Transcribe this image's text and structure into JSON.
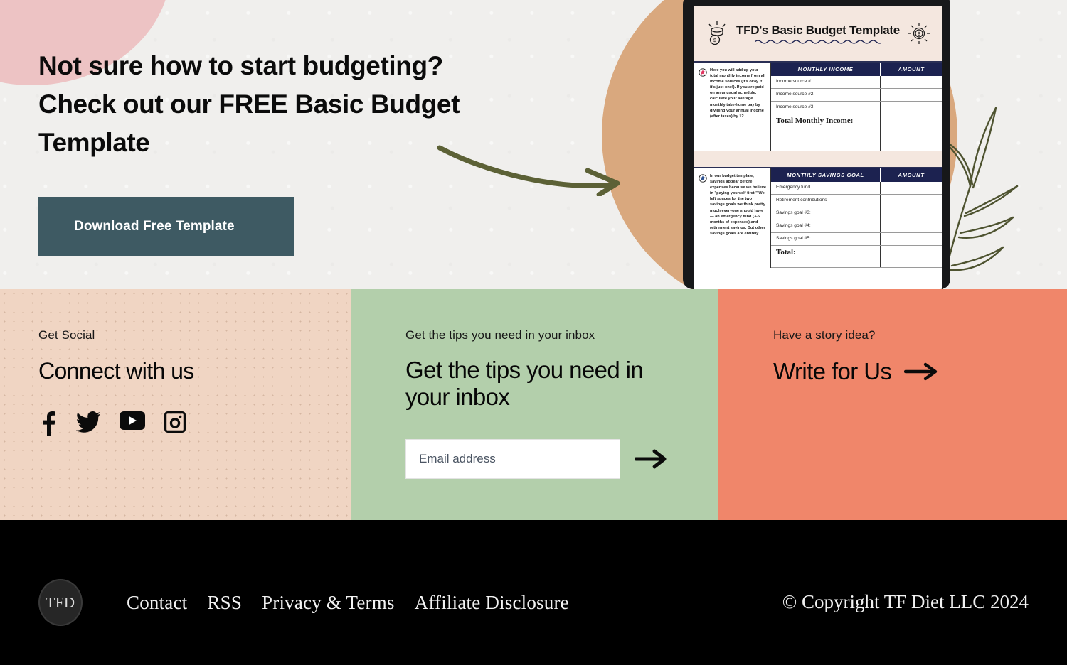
{
  "hero": {
    "title": "Not sure how to start budgeting? Check out our FREE Basic Budget Template",
    "cta_label": "Download Free Template",
    "cta_color": "#3e5a63",
    "background_color": "#f0efed",
    "blob_pink_color": "#edc3c4",
    "blob_tan_color": "#d9a87e",
    "arrow_color": "#5c6136",
    "leaf_color": "#5c6136",
    "arrow_icon": "curved-arrow-right-icon",
    "leaf_icon": "botanical-leaf-icon"
  },
  "template_preview": {
    "device": "tablet",
    "doc_title": "TFD's Basic Budget Template",
    "header_bg": "#f4e7df",
    "table_header_bg": "#1c2250",
    "coins_icon": "coin-stack-icon",
    "sun_icon": "sun-dollar-icon",
    "sections": [
      {
        "note_star_color": "#e0325e",
        "note": "Here you will add up your total monthly income from all income sources (it's okay if it's just one!). If you are paid on an unusual schedule, calculate your average monthly take-home pay by dividing your annual income (after taxes) by 12.",
        "col_label": "MONTHLY INCOME",
        "col_amount": "AMOUNT",
        "rows": [
          "Income source #1:",
          "Income source #2:",
          "Income source #3:"
        ],
        "total_label": "Total Monthly Income:"
      },
      {
        "note_star_color": "#2a4f8f",
        "note": "In our budget template, savings appear before expenses because we believe in \"paying yourself first.\" We left spaces for the two savings goals we think pretty much everyone should have — an emergency fund (3-6 months of expenses) and retirement savings. But other savings goals are entirely",
        "col_label": "MONTHLY SAVINGS GOAL",
        "col_amount": "AMOUNT",
        "rows": [
          "Emergency fund",
          "Retirement contributions",
          "Savings goal #3:",
          "Savings goal #4:",
          "Savings goal #5:"
        ],
        "total_label": "Total:"
      }
    ]
  },
  "panels": {
    "social": {
      "eyebrow": "Get Social",
      "heading": "Connect with us",
      "bg_color": "#f0d5c3",
      "icons": [
        {
          "name": "facebook-icon",
          "label": "Facebook"
        },
        {
          "name": "twitter-icon",
          "label": "Twitter"
        },
        {
          "name": "youtube-icon",
          "label": "YouTube"
        },
        {
          "name": "instagram-icon",
          "label": "Instagram"
        }
      ]
    },
    "newsletter": {
      "eyebrow": "Get the tips you need in your inbox",
      "heading": "Get the tips you need in your inbox",
      "bg_color": "#b3cfab",
      "email_placeholder": "Email address",
      "email_value": "",
      "submit_icon": "arrow-right-icon"
    },
    "write": {
      "eyebrow": "Have a story idea?",
      "heading": "Write for Us",
      "bg_color": "#f0866a",
      "arrow_icon": "arrow-right-icon"
    }
  },
  "footer": {
    "bg_color": "#000000",
    "logo_text": "TFD",
    "links": [
      "Contact",
      "RSS",
      "Privacy & Terms",
      "Affiliate Disclosure"
    ],
    "copyright": "© Copyright TF Diet LLC 2024"
  }
}
